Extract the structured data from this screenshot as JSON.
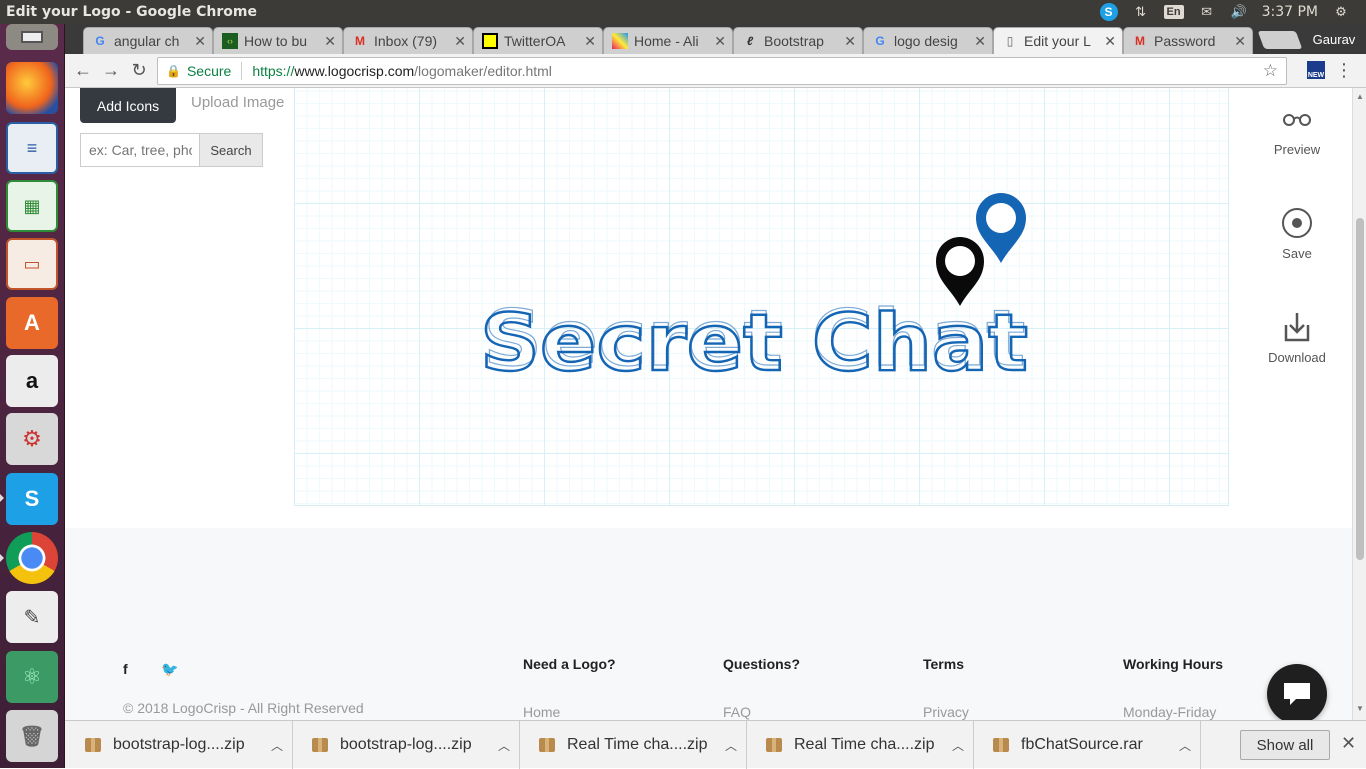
{
  "os": {
    "window_title": "Edit your Logo - Google Chrome",
    "tray": {
      "keyboard_layout": "En",
      "time": "3:37 PM"
    }
  },
  "launcher": [
    {
      "name": "files"
    },
    {
      "name": "firefox"
    },
    {
      "name": "writer"
    },
    {
      "name": "calc"
    },
    {
      "name": "impress"
    },
    {
      "name": "software-center"
    },
    {
      "name": "amazon"
    },
    {
      "name": "settings"
    },
    {
      "name": "skype"
    },
    {
      "name": "chrome"
    },
    {
      "name": "text-editor"
    },
    {
      "name": "atom"
    },
    {
      "name": "trash"
    }
  ],
  "tabs": [
    {
      "title": "angular ch",
      "favicon": "google"
    },
    {
      "title": "How to bu",
      "favicon": "code"
    },
    {
      "title": "Inbox (79)",
      "favicon": "gmail"
    },
    {
      "title": "TwitterOA",
      "favicon": "qr"
    },
    {
      "title": "Home - Ali",
      "favicon": "colorful"
    },
    {
      "title": "Bootstrap",
      "favicon": "script"
    },
    {
      "title": "logo desig",
      "favicon": "google"
    },
    {
      "title": "Edit your L",
      "favicon": "page"
    },
    {
      "title": "Password",
      "favicon": "gmail"
    }
  ],
  "profile_name": "Gaurav",
  "address": {
    "secure_label": "Secure",
    "scheme": "https://",
    "host": "www.logocrisp.com",
    "path": "/logomaker/editor.html"
  },
  "editor": {
    "add_icons_label": "Add Icons",
    "upload_label": "Upload Image",
    "search_placeholder": "ex: Car, tree, phone",
    "search_button": "Search",
    "logo_text": "Secret Chat",
    "logo_color": "#1565b5",
    "pin_dark_color": "#0a0a0a",
    "pin_blue_color": "#1565b5"
  },
  "side_actions": {
    "preview": "Preview",
    "save": "Save",
    "download": "Download"
  },
  "footer": {
    "copyright": "© 2018 LogoCrisp - All Right Reserved",
    "columns": [
      {
        "title": "Need a Logo?",
        "link": "Home"
      },
      {
        "title": "Questions?",
        "link": "FAQ"
      },
      {
        "title": "Terms",
        "link": "Privacy"
      },
      {
        "title": "Working Hours",
        "link": "Monday-Friday"
      }
    ]
  },
  "downloads": [
    {
      "name": "bootstrap-log....zip"
    },
    {
      "name": "bootstrap-log....zip"
    },
    {
      "name": "Real Time cha....zip"
    },
    {
      "name": "Real Time cha....zip"
    },
    {
      "name": "fbChatSource.rar"
    }
  ],
  "show_all_label": "Show all"
}
